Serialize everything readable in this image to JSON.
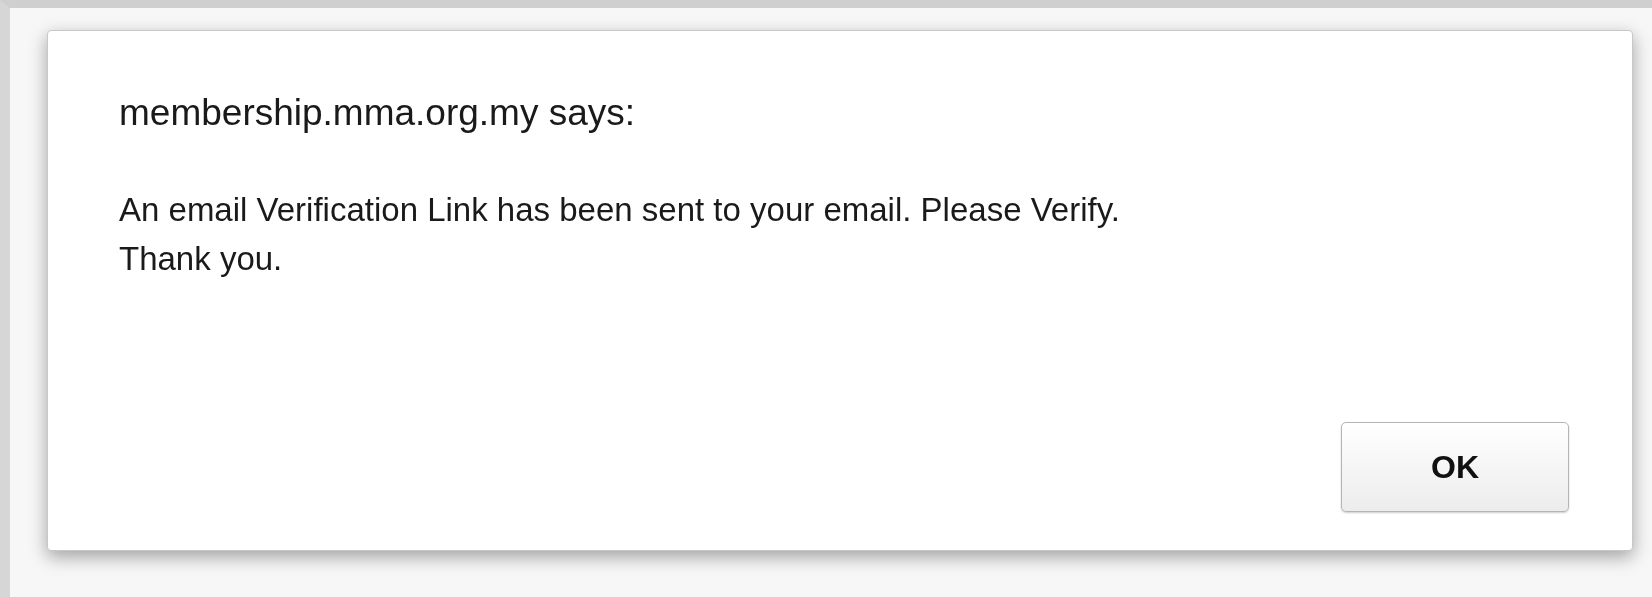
{
  "dialog": {
    "title": "membership.mma.org.my says:",
    "message": [
      "An email Verification Link has been sent to your email. Please Verify.",
      "Thank you."
    ],
    "buttons": [
      {
        "label": "OK",
        "default": true
      }
    ]
  }
}
